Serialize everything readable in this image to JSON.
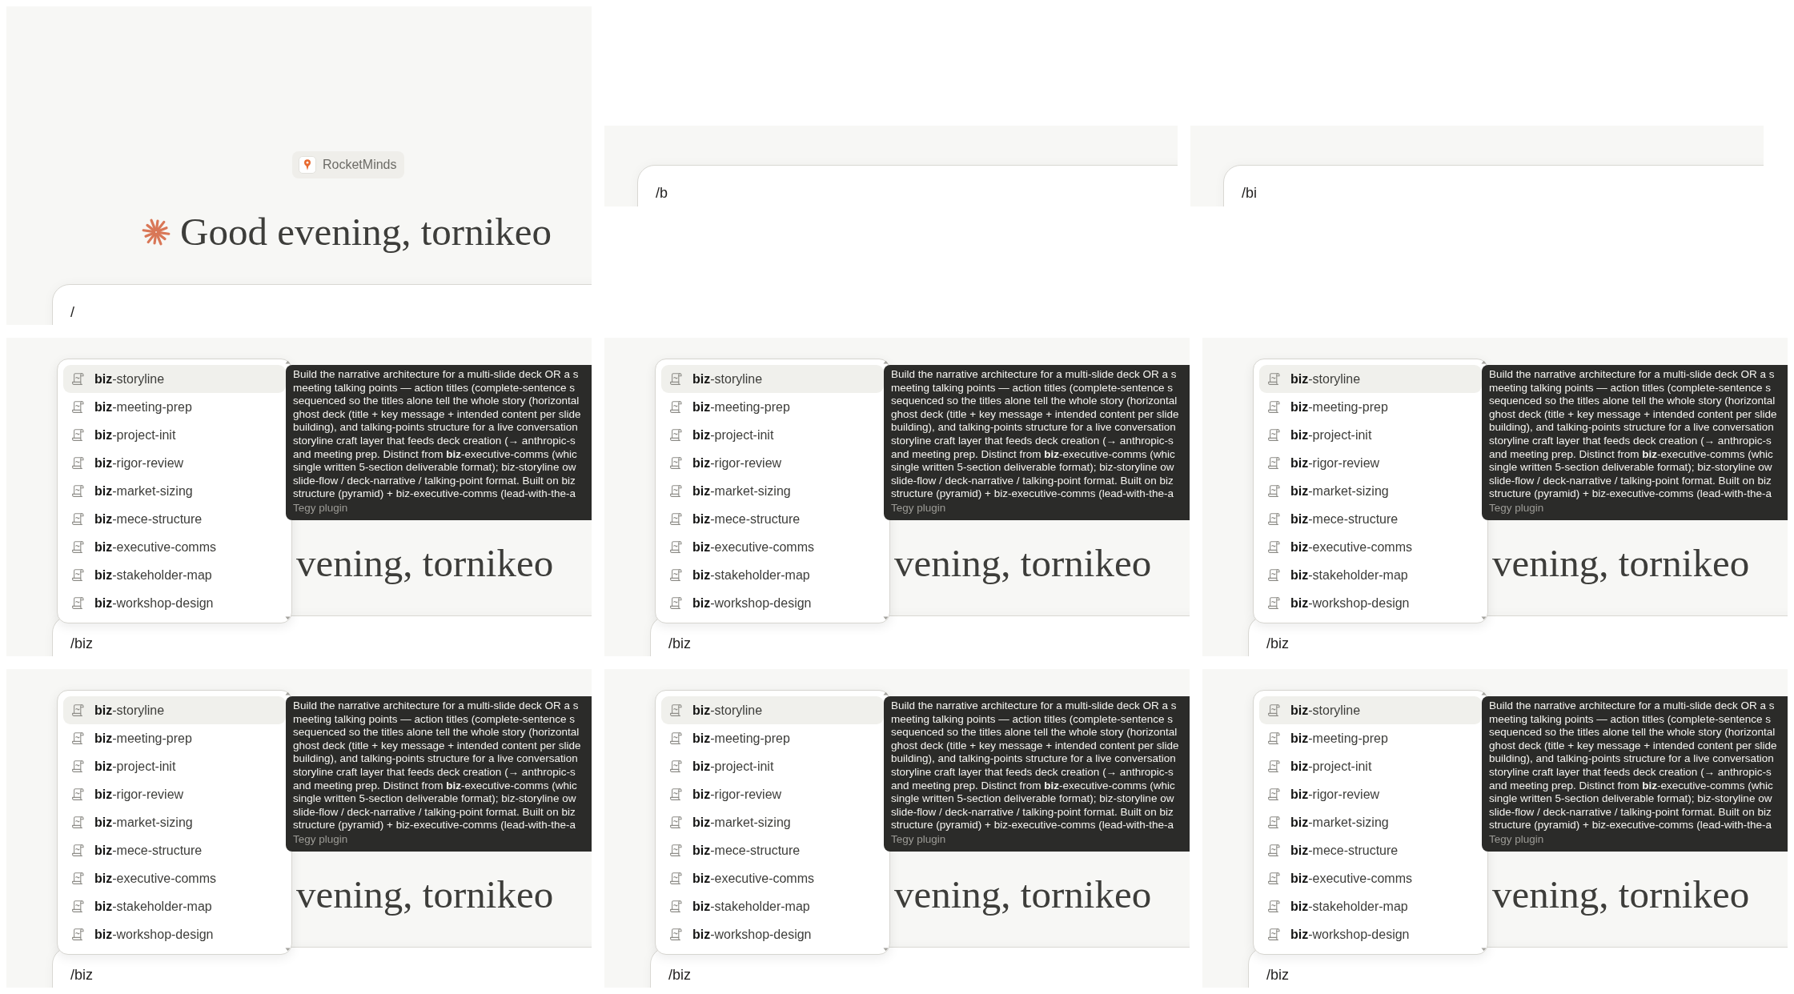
{
  "panels": [
    {
      "kind": "home",
      "plugin_badge": "RocketMinds",
      "greeting": "Good evening, tornikeo",
      "input": {
        "value": "/"
      }
    },
    {
      "kind": "input_only",
      "input": {
        "value": "/b"
      }
    },
    {
      "kind": "input_only",
      "input": {
        "value": "/bi"
      }
    },
    {
      "kind": "menu",
      "greeting": "vening, tornikeo",
      "menu": {
        "items": [
          {
            "label": "**biz**-storyline",
            "selected": true
          },
          {
            "label": "**biz**-meeting-prep",
            "selected": false
          },
          {
            "label": "**biz**-project-init",
            "selected": false
          },
          {
            "label": "**biz**-rigor-review",
            "selected": false
          },
          {
            "label": "**biz**-market-sizing",
            "selected": false
          },
          {
            "label": "**biz**-mece-structure",
            "selected": false
          },
          {
            "label": "**biz**-executive-comms",
            "selected": false
          },
          {
            "label": "**biz**-stakeholder-map",
            "selected": false
          },
          {
            "label": "**biz**-workshop-design",
            "selected": false
          }
        ]
      },
      "tooltip": {
        "description_lines": [
          "Build the narrative architecture for a multi-slide deck OR a s",
          "meeting talking points — action titles (complete-sentence s",
          "sequenced so the titles alone tell the whole story (horizontal",
          "ghost deck (title + key message + intended content per slide",
          "building), and talking-points structure for a live conversation",
          "storyline craft layer that feeds deck creation (→ anthropic-s",
          "and meeting prep. Distinct from **biz**-executive-comms (whic",
          "single written 5-section deliverable format); biz-storyline ow",
          "slide-flow / deck-narrative / talking-point format. Built on biz",
          "structure (pyramid) + biz-executive-comms (lead-with-the-a"
        ],
        "source": "Tegy plugin"
      },
      "input": {
        "value": "/biz"
      }
    },
    {
      "kind": "menu",
      "greeting": "vening, tornikeo",
      "menu": {
        "items": [
          {
            "label": "**biz**-storyline",
            "selected": true
          },
          {
            "label": "**biz**-meeting-prep",
            "selected": false
          },
          {
            "label": "**biz**-project-init",
            "selected": false
          },
          {
            "label": "**biz**-rigor-review",
            "selected": false
          },
          {
            "label": "**biz**-market-sizing",
            "selected": false
          },
          {
            "label": "**biz**-mece-structure",
            "selected": false
          },
          {
            "label": "**biz**-executive-comms",
            "selected": false
          },
          {
            "label": "**biz**-stakeholder-map",
            "selected": false
          },
          {
            "label": "**biz**-workshop-design",
            "selected": false
          }
        ]
      },
      "tooltip": {
        "description_lines": [
          "Build the narrative architecture for a multi-slide deck OR a s",
          "meeting talking points — action titles (complete-sentence s",
          "sequenced so the titles alone tell the whole story (horizontal",
          "ghost deck (title + key message + intended content per slide",
          "building), and talking-points structure for a live conversation",
          "storyline craft layer that feeds deck creation (→ anthropic-s",
          "and meeting prep. Distinct from **biz**-executive-comms (whic",
          "single written 5-section deliverable format); biz-storyline ow",
          "slide-flow / deck-narrative / talking-point format. Built on biz",
          "structure (pyramid) + biz-executive-comms (lead-with-the-a"
        ],
        "source": "Tegy plugin"
      },
      "input": {
        "value": "/biz"
      }
    },
    {
      "kind": "menu",
      "greeting": "vening, tornikeo",
      "menu": {
        "items": [
          {
            "label": "**biz**-storyline",
            "selected": true
          },
          {
            "label": "**biz**-meeting-prep",
            "selected": false
          },
          {
            "label": "**biz**-project-init",
            "selected": false
          },
          {
            "label": "**biz**-rigor-review",
            "selected": false
          },
          {
            "label": "**biz**-market-sizing",
            "selected": false
          },
          {
            "label": "**biz**-mece-structure",
            "selected": false
          },
          {
            "label": "**biz**-executive-comms",
            "selected": false
          },
          {
            "label": "**biz**-stakeholder-map",
            "selected": false
          },
          {
            "label": "**biz**-workshop-design",
            "selected": false
          }
        ]
      },
      "tooltip": {
        "description_lines": [
          "Build the narrative architecture for a multi-slide deck OR a s",
          "meeting talking points — action titles (complete-sentence s",
          "sequenced so the titles alone tell the whole story (horizontal",
          "ghost deck (title + key message + intended content per slide",
          "building), and talking-points structure for a live conversation",
          "storyline craft layer that feeds deck creation (→ anthropic-s",
          "and meeting prep. Distinct from **biz**-executive-comms (whic",
          "single written 5-section deliverable format); biz-storyline ow",
          "slide-flow / deck-narrative / talking-point format. Built on biz",
          "structure (pyramid) + biz-executive-comms (lead-with-the-a"
        ],
        "source": "Tegy plugin"
      },
      "input": {
        "value": "/biz"
      }
    },
    {
      "kind": "menu",
      "greeting": "vening, tornikeo",
      "menu": {
        "items": [
          {
            "label": "**biz**-storyline",
            "selected": true
          },
          {
            "label": "**biz**-meeting-prep",
            "selected": false
          },
          {
            "label": "**biz**-project-init",
            "selected": false
          },
          {
            "label": "**biz**-rigor-review",
            "selected": false
          },
          {
            "label": "**biz**-market-sizing",
            "selected": false
          },
          {
            "label": "**biz**-mece-structure",
            "selected": false
          },
          {
            "label": "**biz**-executive-comms",
            "selected": false
          },
          {
            "label": "**biz**-stakeholder-map",
            "selected": false
          },
          {
            "label": "**biz**-workshop-design",
            "selected": false
          }
        ]
      },
      "tooltip": {
        "description_lines": [
          "Build the narrative architecture for a multi-slide deck OR a s",
          "meeting talking points — action titles (complete-sentence s",
          "sequenced so the titles alone tell the whole story (horizontal",
          "ghost deck (title + key message + intended content per slide",
          "building), and talking-points structure for a live conversation",
          "storyline craft layer that feeds deck creation (→ anthropic-s",
          "and meeting prep. Distinct from **biz**-executive-comms (whic",
          "single written 5-section deliverable format); biz-storyline ow",
          "slide-flow / deck-narrative / talking-point format. Built on biz",
          "structure (pyramid) + biz-executive-comms (lead-with-the-a"
        ],
        "source": "Tegy plugin"
      },
      "input": {
        "value": "/biz"
      }
    },
    {
      "kind": "menu",
      "greeting": "vening, tornikeo",
      "menu": {
        "items": [
          {
            "label": "**biz**-storyline",
            "selected": true
          },
          {
            "label": "**biz**-meeting-prep",
            "selected": false
          },
          {
            "label": "**biz**-project-init",
            "selected": false
          },
          {
            "label": "**biz**-rigor-review",
            "selected": false
          },
          {
            "label": "**biz**-market-sizing",
            "selected": false
          },
          {
            "label": "**biz**-mece-structure",
            "selected": false
          },
          {
            "label": "**biz**-executive-comms",
            "selected": false
          },
          {
            "label": "**biz**-stakeholder-map",
            "selected": false
          },
          {
            "label": "**biz**-workshop-design",
            "selected": false
          }
        ]
      },
      "tooltip": {
        "description_lines": [
          "Build the narrative architecture for a multi-slide deck OR a s",
          "meeting talking points — action titles (complete-sentence s",
          "sequenced so the titles alone tell the whole story (horizontal",
          "ghost deck (title + key message + intended content per slide",
          "building), and talking-points structure for a live conversation",
          "storyline craft layer that feeds deck creation (→ anthropic-s",
          "and meeting prep. Distinct from **biz**-executive-comms (whic",
          "single written 5-section deliverable format); biz-storyline ow",
          "slide-flow / deck-narrative / talking-point format. Built on biz",
          "structure (pyramid) + biz-executive-comms (lead-with-the-a"
        ],
        "source": "Tegy plugin"
      },
      "input": {
        "value": "/biz"
      }
    },
    {
      "kind": "menu",
      "greeting": "vening, tornikeo",
      "menu": {
        "items": [
          {
            "label": "**biz**-storyline",
            "selected": true
          },
          {
            "label": "**biz**-meeting-prep",
            "selected": false
          },
          {
            "label": "**biz**-project-init",
            "selected": false
          },
          {
            "label": "**biz**-rigor-review",
            "selected": false
          },
          {
            "label": "**biz**-market-sizing",
            "selected": false
          },
          {
            "label": "**biz**-mece-structure",
            "selected": false
          },
          {
            "label": "**biz**-executive-comms",
            "selected": false
          },
          {
            "label": "**biz**-stakeholder-map",
            "selected": false
          },
          {
            "label": "**biz**-workshop-design",
            "selected": false
          }
        ]
      },
      "tooltip": {
        "description_lines": [
          "Build the narrative architecture for a multi-slide deck OR a s",
          "meeting talking points — action titles (complete-sentence s",
          "sequenced so the titles alone tell the whole story (horizontal",
          "ghost deck (title + key message + intended content per slide",
          "building), and talking-points structure for a live conversation",
          "storyline craft layer that feeds deck creation (→ anthropic-s",
          "and meeting prep. Distinct from **biz**-executive-comms (whic",
          "single written 5-section deliverable format); biz-storyline ow",
          "slide-flow / deck-narrative / talking-point format. Built on biz",
          "structure (pyramid) + biz-executive-comms (lead-with-the-a"
        ],
        "source": "Tegy plugin"
      },
      "input": {
        "value": "/biz"
      }
    }
  ]
}
